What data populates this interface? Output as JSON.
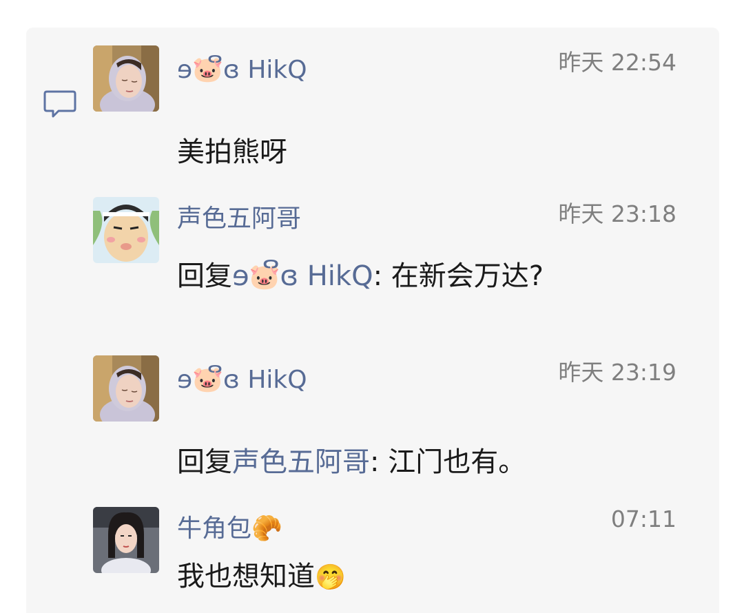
{
  "icons": {
    "comment": "comment-bubble-icon",
    "pig": "pig-face-emoji",
    "croissant": "croissant-emoji",
    "hand_over_mouth": "face-with-hand-over-mouth-emoji",
    "swirl": "swirl-ornament-icon"
  },
  "colors": {
    "name_link": "#576b95",
    "timestamp": "#7f7f7f",
    "panel_bg": "#f6f6f6",
    "text": "#1a1a1a"
  },
  "comments": [
    {
      "author_prefix": "ɘ",
      "author_suffix": "ɞ  HikQ",
      "time": "昨天 22:54",
      "text": "美拍熊呀"
    },
    {
      "author": "声色五阿哥",
      "time": "昨天 23:18",
      "reply_label": "回复",
      "reply_to_prefix": "ɘ",
      "reply_to_suffix": "ɞ  HikQ",
      "text": ": 在新会万达?"
    },
    {
      "author_prefix": "ɘ",
      "author_suffix": "ɞ  HikQ",
      "time": "昨天 23:19",
      "reply_label": "回复",
      "reply_to": "声色五阿哥",
      "text": ": 江门也有。"
    },
    {
      "author": "牛角包",
      "time": "07:11",
      "text": "我也想知道"
    }
  ]
}
